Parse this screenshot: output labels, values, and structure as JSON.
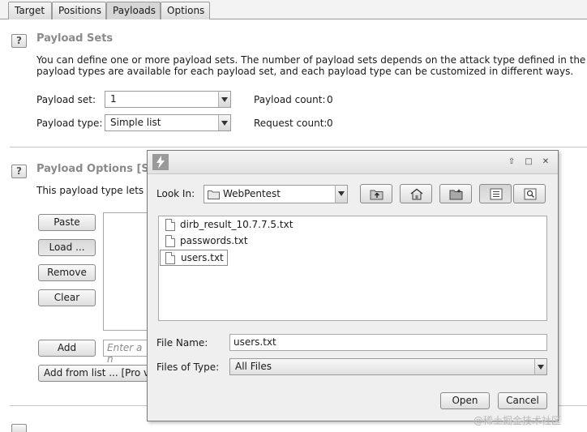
{
  "tabs": [
    {
      "label": "Target"
    },
    {
      "label": "Positions"
    },
    {
      "label": "Payloads"
    },
    {
      "label": "Options"
    }
  ],
  "active_tab": "Payloads",
  "payload_sets": {
    "help": "?",
    "title": "Payload Sets",
    "description_line1": "You can define one or more payload sets. The number of payload sets depends on the attack type defined in the Positi",
    "description_line2": "payload types are available for each payload set, and each payload type can be customized in different ways.",
    "set_label": "Payload set:",
    "set_value": "1",
    "type_label": "Payload type:",
    "type_value": "Simple list",
    "count_label": "Payload count:",
    "count_value": "0",
    "request_label": "Request count:",
    "request_value": "0"
  },
  "payload_options": {
    "help": "?",
    "title": "Payload Options [S",
    "description": "This payload type lets y",
    "buttons": {
      "paste": "Paste",
      "load": "Load ...",
      "remove": "Remove",
      "clear": "Clear",
      "add": "Add",
      "add_from_list": "Add from list ... [Pro v"
    },
    "add_placeholder": "Enter a n"
  },
  "dialog": {
    "look_in_label": "Look In:",
    "look_in_value": "WebPentest",
    "files": [
      {
        "name": "dirb_result_10.7.7.5.txt"
      },
      {
        "name": "passwords.txt"
      },
      {
        "name": "users.txt"
      }
    ],
    "selected_file": "users.txt",
    "file_name_label": "File Name:",
    "file_name_value": "users.txt",
    "files_of_type_label": "Files of Type:",
    "files_of_type_value": "All Files",
    "open_label": "Open",
    "cancel_label": "Cancel",
    "title_buttons": {
      "up": "⇧",
      "max": "□",
      "close": "✕"
    }
  },
  "watermark": "@稀土掘金技术社区"
}
